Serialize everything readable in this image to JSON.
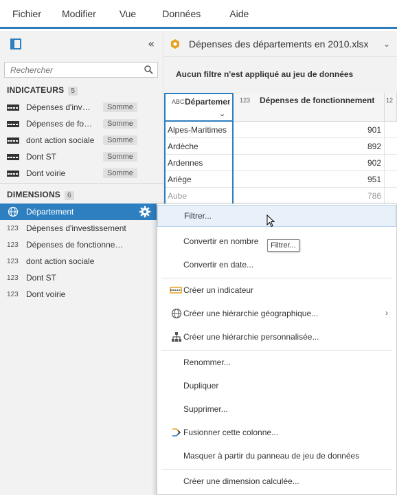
{
  "menubar": {
    "items": [
      "Fichier",
      "Modifier",
      "Vue",
      "Données",
      "Aide"
    ]
  },
  "leftpanel": {
    "collapse_glyph": "«",
    "search_placeholder": "Rechercher",
    "measures": {
      "title": "INDICATEURS",
      "count": "5",
      "items": [
        {
          "label": "Dépenses d'investissement",
          "agg": "Somme"
        },
        {
          "label": "Dépenses de fonctionnement",
          "agg": "Somme"
        },
        {
          "label": "dont action sociale",
          "agg": "Somme"
        },
        {
          "label": "Dont ST",
          "agg": "Somme"
        },
        {
          "label": "Dont voirie",
          "agg": "Somme"
        }
      ]
    },
    "dimensions": {
      "title": "DIMENSIONS",
      "count": "6",
      "items": [
        {
          "label": "Département",
          "type": "geo",
          "selected": true
        },
        {
          "label": "Dépenses d'investissement",
          "type": "123"
        },
        {
          "label": "Dépenses de fonctionnement",
          "type": "123"
        },
        {
          "label": "dont action sociale",
          "type": "123"
        },
        {
          "label": "Dont ST",
          "type": "123"
        },
        {
          "label": "Dont voirie",
          "type": "123"
        }
      ]
    }
  },
  "dataset": {
    "title": "Dépenses des départements en 2010.xlsx",
    "filter_status": "Aucun filtre n'est appliqué au jeu de données"
  },
  "grid": {
    "col1": {
      "type": "ABC",
      "name": "Département"
    },
    "col2": {
      "type": "123",
      "name": "Dépenses de fonctionnement"
    },
    "col3": {
      "type": "12"
    },
    "rows": [
      {
        "c1": "Alpes-Maritimes",
        "c2": "901"
      },
      {
        "c1": "Ardèche",
        "c2": "892"
      },
      {
        "c1": "Ardennes",
        "c2": "902"
      },
      {
        "c1": "Ariège",
        "c2": "951"
      },
      {
        "c1": "Aube",
        "c2": "786"
      }
    ]
  },
  "context_menu": {
    "items": [
      {
        "label": "Filtrer...",
        "icon": null,
        "hover": true
      },
      {
        "label": "Convertir en nombre",
        "icon": null
      },
      {
        "label": "Convertir en date...",
        "icon": null
      },
      {
        "label": "Créer un indicateur",
        "icon": "measure-icon"
      },
      {
        "label": "Créer une hiérarchie géographique...",
        "icon": "globe-icon",
        "submenu": true
      },
      {
        "label": "Créer une hiérarchie personnalisée...",
        "icon": "hierarchy-icon"
      },
      {
        "label": "Renommer...",
        "icon": null
      },
      {
        "label": "Dupliquer",
        "icon": null
      },
      {
        "label": "Supprimer...",
        "icon": null
      },
      {
        "label": "Fusionner cette colonne...",
        "icon": "merge-icon"
      },
      {
        "label": "Masquer à partir du panneau de jeu de données",
        "icon": null
      },
      {
        "label": "Créer une dimension calculée...",
        "icon": null
      }
    ]
  },
  "tooltip": "Filtrer...",
  "colors": {
    "accent": "#2e7fc0",
    "panel_bg": "#f2f2f2",
    "dataset_icon": "#e8a020"
  }
}
